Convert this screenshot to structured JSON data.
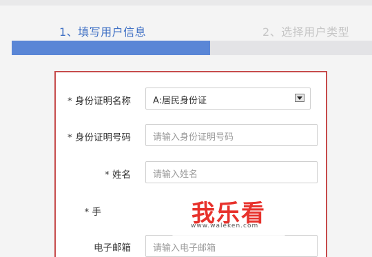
{
  "steps": [
    {
      "label": "1、填写用户信息"
    },
    {
      "label": "2、选择用户类型"
    }
  ],
  "progress": {
    "fraction": 0.55
  },
  "form": {
    "id_type_label": "* 身份证明名称",
    "id_type_value": "A:居民身份证",
    "id_number_label": "* 身份证明号码",
    "id_number_placeholder": "请输入身份证明号码",
    "name_label": "* 姓名",
    "name_placeholder": "请输入姓名",
    "phone_label": "* 手",
    "email_label": "电子邮箱",
    "email_placeholder": "请输入电子邮箱"
  },
  "watermark": {
    "title": "我乐看",
    "url": "www.waleken.com"
  },
  "colors": {
    "active_step": "#3e6fc4",
    "inactive_step": "#c6c6c6",
    "progress_fill": "#5a86d6",
    "form_border": "#c64b4b",
    "watermark": "#e7322c"
  },
  "icons": {
    "select_arrow": "chevron-down-icon"
  }
}
